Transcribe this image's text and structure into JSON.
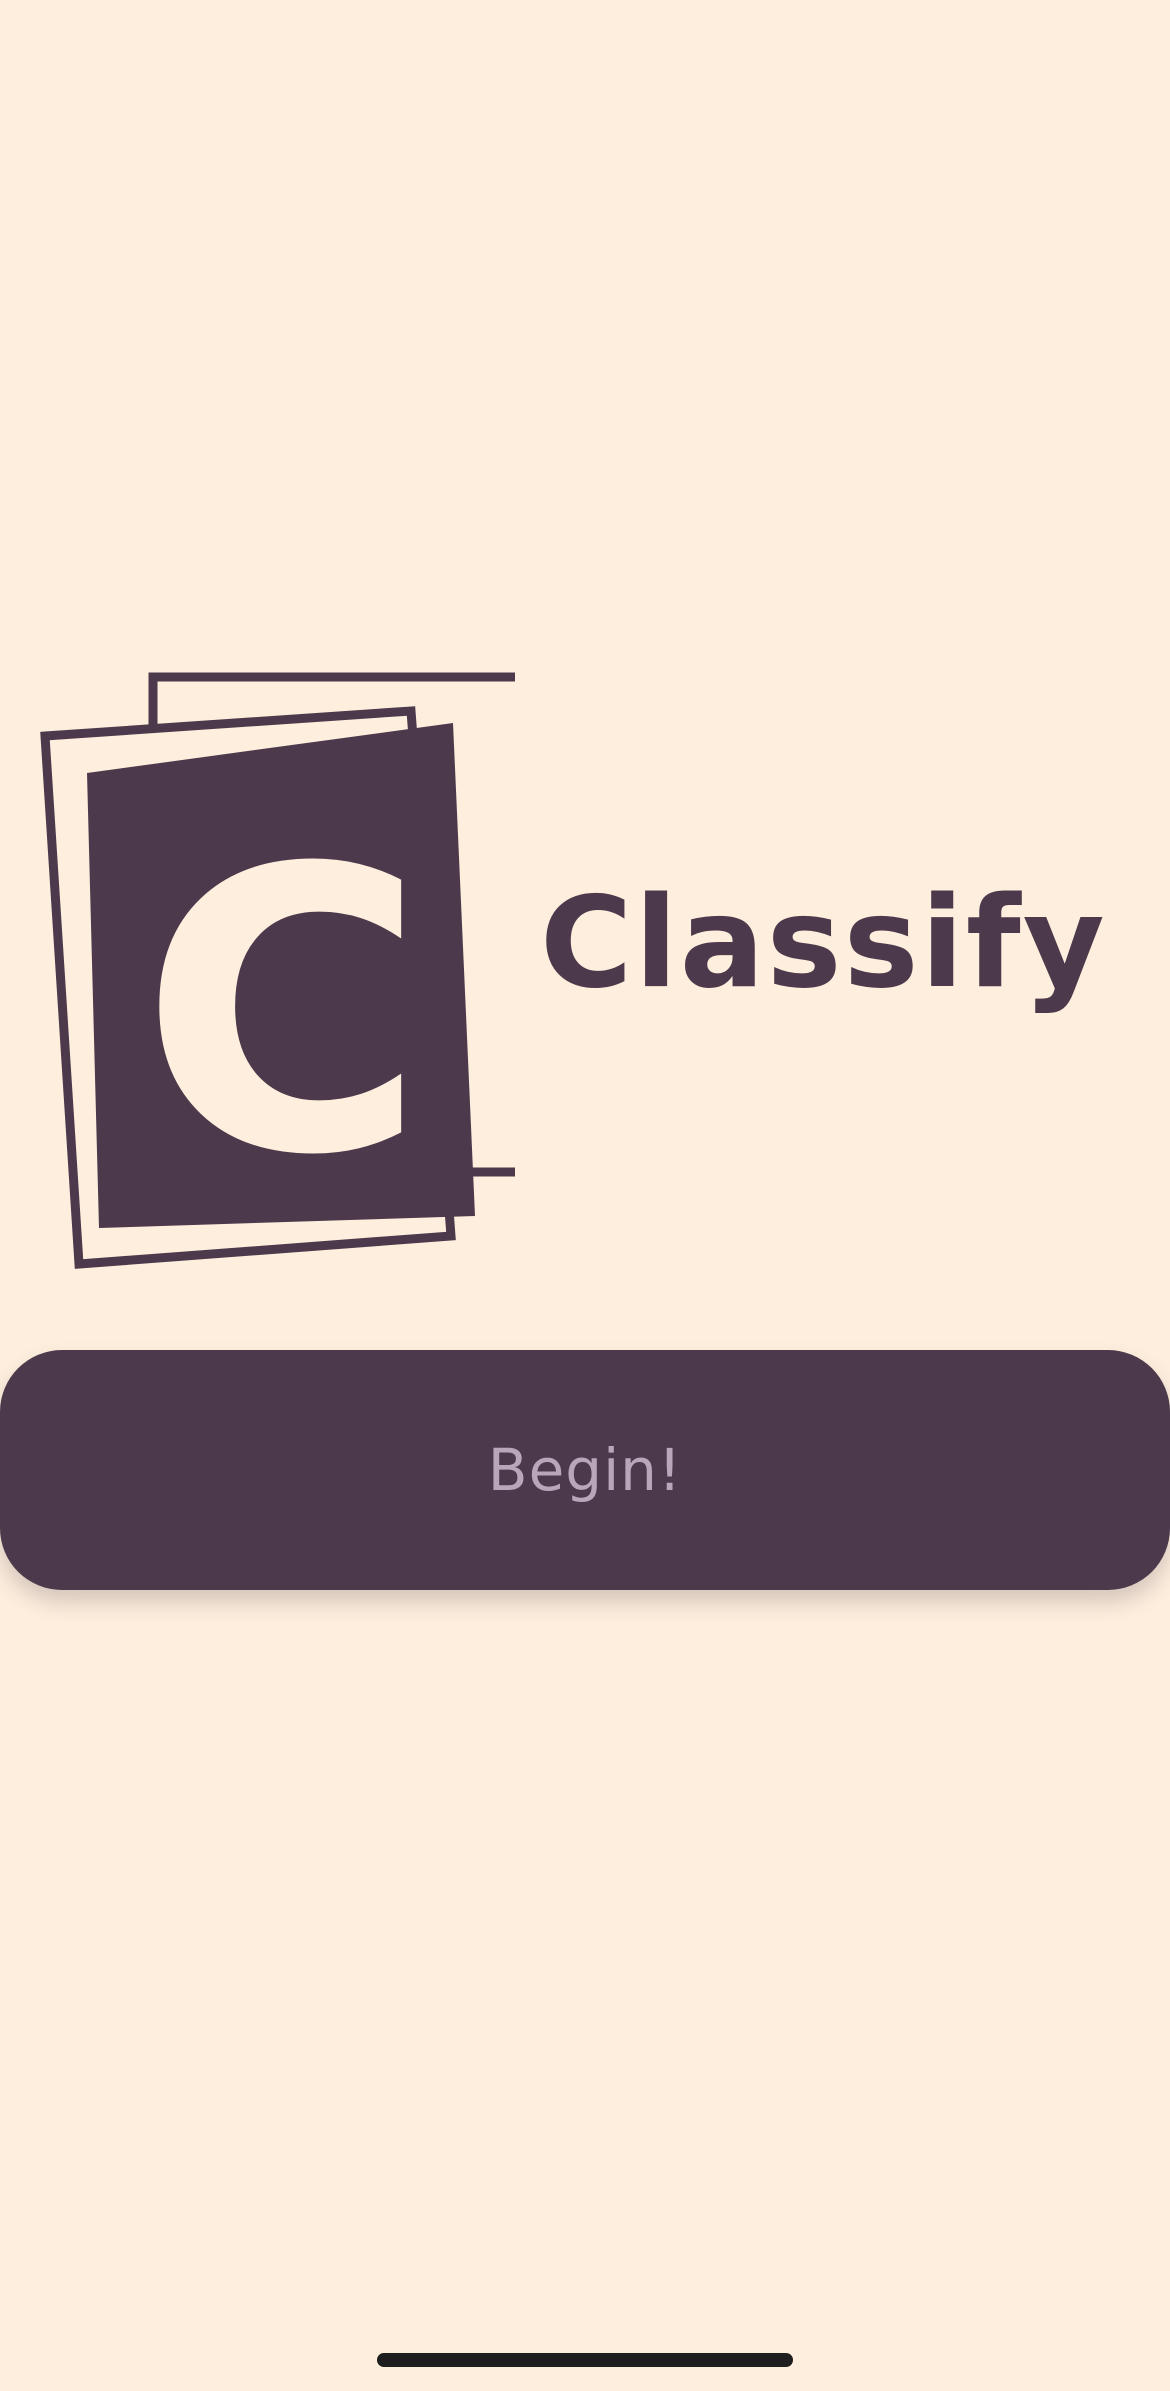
{
  "app": {
    "name": "Classify",
    "logo_letter": "C"
  },
  "actions": {
    "begin_label": "Begin!"
  },
  "colors": {
    "background": "#FDEEDD",
    "brand": "#4C3A4C",
    "button_text": "#B9A6BA",
    "home_indicator": "#1E1E1E"
  },
  "icons": {
    "logo": "stacked-cards-logo-icon"
  }
}
